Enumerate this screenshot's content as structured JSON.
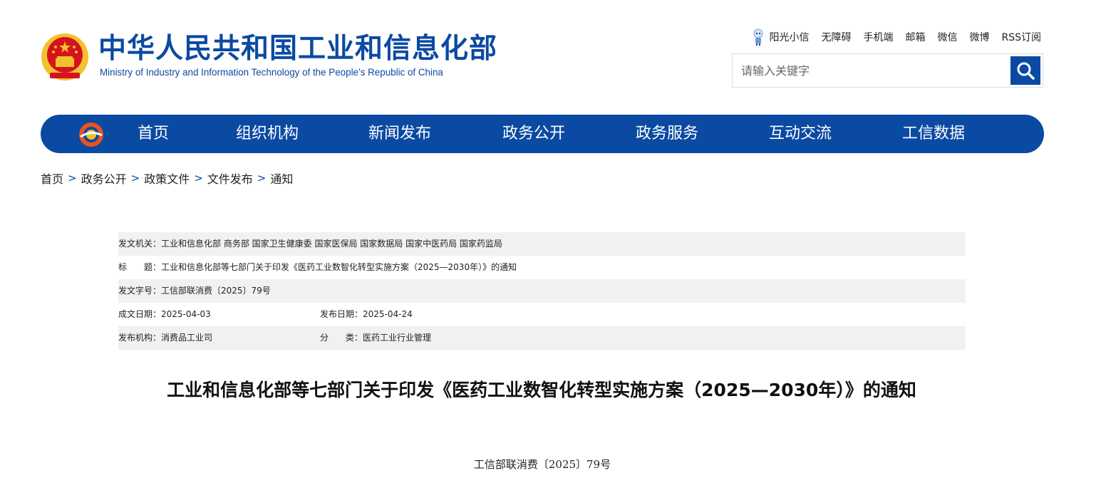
{
  "site": {
    "title_cn": "中华人民共和国工业和信息化部",
    "title_en": "Ministry of Industry and Information Technology of the People’s Republic of China"
  },
  "toplinks": [
    "阳光小信",
    "无障碍",
    "手机端",
    "邮箱",
    "微信",
    "微博",
    "RSS订阅"
  ],
  "search": {
    "placeholder": "请输入关键字"
  },
  "nav": [
    "首页",
    "组织机构",
    "新闻发布",
    "政务公开",
    "政务服务",
    "互动交流",
    "工信数据"
  ],
  "breadcrumb": [
    "首页",
    "政务公开",
    "政策文件",
    "文件发布",
    "通知"
  ],
  "breadcrumb_sep": ">",
  "meta": {
    "issuer": "发文机关：工业和信息化部 商务部 国家卫生健康委 国家医保局 国家数据局 国家中医药局 国家药监局",
    "subject": "标　　题：工业和信息化部等七部门关于印发《医药工业数智化转型实施方案（2025—2030年）》的通知",
    "doc_no": "发文字号：工信部联消费〔2025〕79号",
    "created": "成文日期：2025-04-03",
    "published": "发布日期：2025-04-24",
    "org": "发布机构：消费品工业司",
    "category": "分　　类：医药工业行业管理"
  },
  "article": {
    "title": "工业和信息化部等七部门关于印发《医药工业数智化转型实施方案（2025—2030年）》的通知",
    "number": "工信部联消费〔2025〕79号"
  },
  "colors": {
    "brand": "#0b4aa2",
    "shade": "#f1f1f1",
    "emblem_red": "#d6121f",
    "emblem_gold": "#f2c12e"
  }
}
